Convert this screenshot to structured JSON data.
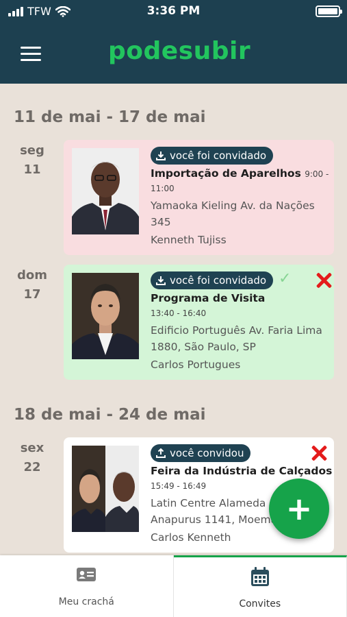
{
  "status": {
    "carrier": "TFW",
    "time": "3:36 PM"
  },
  "app": {
    "logo": "podesubir"
  },
  "weeks": [
    {
      "label": "11 de mai - 17 de mai"
    },
    {
      "label": "18 de mai - 24 de mai"
    }
  ],
  "events": [
    {
      "weekday": "seg",
      "daynum": "11",
      "badge": "você foi convidado",
      "title": "Importação de Aparelhos",
      "time_start": "9:00 -",
      "time_end": "11:00",
      "address1": "Yamaoka Kieling Av. da Nações",
      "address2": "345",
      "people": "Kenneth Tujiss",
      "status": "pending"
    },
    {
      "weekday": "dom",
      "daynum": "17",
      "badge": "você foi convidado",
      "title": "Programa de Visita",
      "time": "13:40 - 16:40",
      "address1": "Edificio Português Av. Faria Lima",
      "address2": "1880, São Paulo, SP",
      "people": "Carlos Portugues",
      "status": "accepted"
    },
    {
      "weekday": "sex",
      "daynum": "22",
      "badge": "você convidou",
      "title": "Feira da Indústria de Calçados",
      "time": "15:49 - 16:49",
      "address1": "Latin Centre Alameda",
      "address2": "Anapurus 1141, Moema",
      "people": "Carlos Kenneth",
      "status": "sent"
    }
  ],
  "fab": {
    "label": "+"
  },
  "nav": [
    {
      "label": "Meu crachá",
      "icon": "id-card-icon"
    },
    {
      "label": "Convites",
      "icon": "calendar-icon",
      "active": true
    }
  ],
  "colors": {
    "header": "#1d4050",
    "accent": "#16a34a",
    "pending": "#f9dde0",
    "accepted": "#d4f5d7",
    "reject": "#e41b1b"
  }
}
